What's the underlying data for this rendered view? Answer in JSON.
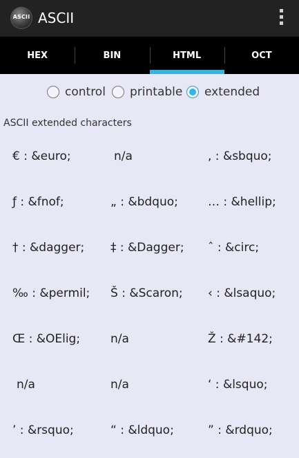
{
  "app": {
    "title": "ASCII",
    "icon_text": "ASCII",
    "icon": "app-icon",
    "menu_icon": "overflow-menu-icon"
  },
  "tabs": [
    {
      "label": "HEX",
      "active": false
    },
    {
      "label": "BIN",
      "active": false
    },
    {
      "label": "HTML",
      "active": true
    },
    {
      "label": "OCT",
      "active": false
    }
  ],
  "filters": {
    "options": [
      {
        "label": "control",
        "checked": false
      },
      {
        "label": "printable",
        "checked": false
      },
      {
        "label": "extended",
        "checked": true
      }
    ]
  },
  "section_title": "ASCII extended characters",
  "rows": [
    [
      "€ : &euro;",
      "n/a",
      ", : &sbquo;"
    ],
    [
      "ƒ : &fnof;",
      "„ : &bdquo;",
      "… : &hellip;"
    ],
    [
      "† : &dagger;",
      "‡ : &Dagger;",
      "ˆ : &circ;"
    ],
    [
      "‰ : &permil;",
      "Š : &Scaron;",
      "‹ : &lsaquo;"
    ],
    [
      "Œ : &OElig;",
      "n/a",
      "Ž : &#142;"
    ],
    [
      "n/a",
      "n/a",
      "‘ : &lsquo;"
    ],
    [
      "’ : &rsquo;",
      "“ : &ldquo;",
      "” : &rdquo;"
    ]
  ],
  "colors": {
    "accent": "#33b5e5",
    "background": "#e7e7f5",
    "actionbar": "#222222",
    "tabbar": "#000000"
  }
}
